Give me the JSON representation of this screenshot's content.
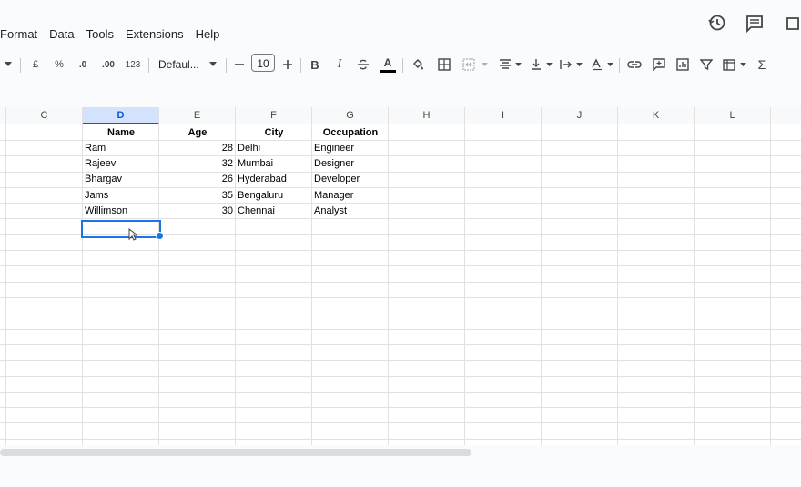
{
  "menu": [
    "Format",
    "Data",
    "Tools",
    "Extensions",
    "Help"
  ],
  "top_icons": [
    "history-icon",
    "comment-icon",
    "meet-icon"
  ],
  "toolbar": {
    "currency": "£",
    "percent": "%",
    "dec_decrease": ".0",
    "dec_increase": ".00",
    "number_format": "123",
    "font_name": "Defaul...",
    "font_size": "10",
    "bold": "B",
    "italic": "I",
    "text_color": "A",
    "sum": "Σ"
  },
  "columns": [
    "C",
    "D",
    "E",
    "F",
    "G",
    "H",
    "I",
    "J",
    "K",
    "L"
  ],
  "selected_column": "D",
  "table": {
    "headers": [
      "Name",
      "Age",
      "City",
      "Occupation"
    ],
    "rows": [
      [
        "Ram",
        "28",
        "Delhi",
        "Engineer"
      ],
      [
        "Rajeev",
        "32",
        "Mumbai",
        "Designer"
      ],
      [
        "Bhargav",
        "26",
        "Hyderabad",
        "Developer"
      ],
      [
        "Jams",
        "35",
        "Bengaluru",
        "Manager"
      ],
      [
        "Willimson",
        "30",
        "Chennai",
        "Analyst"
      ]
    ]
  },
  "colors": {
    "selection": "#1a73e8",
    "header_selected": "#d3e3fd"
  }
}
